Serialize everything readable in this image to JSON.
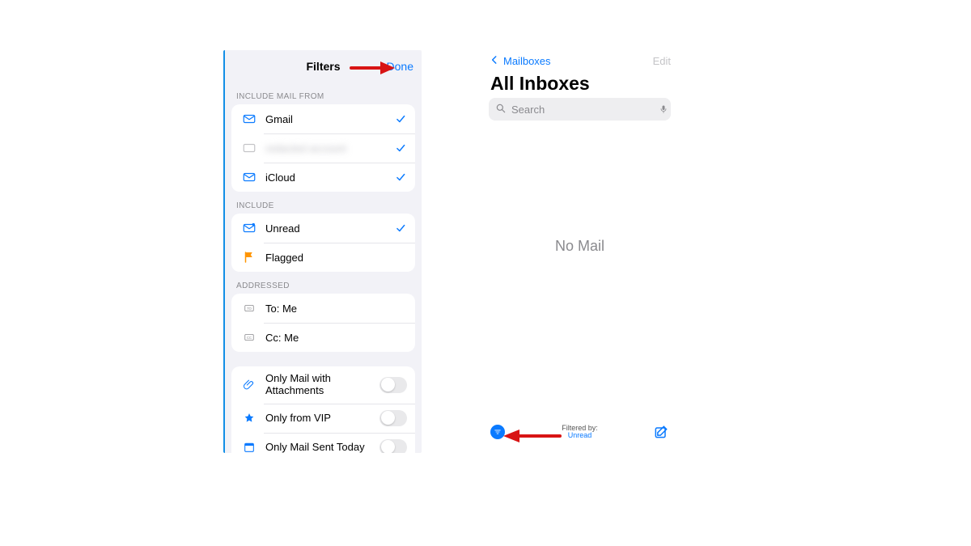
{
  "left": {
    "title": "Filters",
    "done": "Done",
    "sections": {
      "mail_from_label": "INCLUDE MAIL FROM",
      "include_label": "INCLUDE",
      "addressed_label": "ADDRESSED"
    },
    "accounts": {
      "gmail": "Gmail",
      "redacted": "redacted account",
      "icloud": "iCloud"
    },
    "include": {
      "unread": "Unread",
      "flagged": "Flagged"
    },
    "addressed": {
      "to": "To: Me",
      "cc": "Cc: Me"
    },
    "options": {
      "attachments": "Only Mail with Attachments",
      "vip": "Only from VIP",
      "today": "Only Mail Sent Today"
    }
  },
  "right": {
    "back": "Mailboxes",
    "edit": "Edit",
    "title": "All Inboxes",
    "search_placeholder": "Search",
    "empty": "No Mail",
    "filtered_by_label": "Filtered by:",
    "filtered_by_value": "Unread"
  },
  "colors": {
    "ios_blue": "#0a7aff",
    "flag_orange": "#ff9500",
    "arrow_red": "#d81414"
  }
}
